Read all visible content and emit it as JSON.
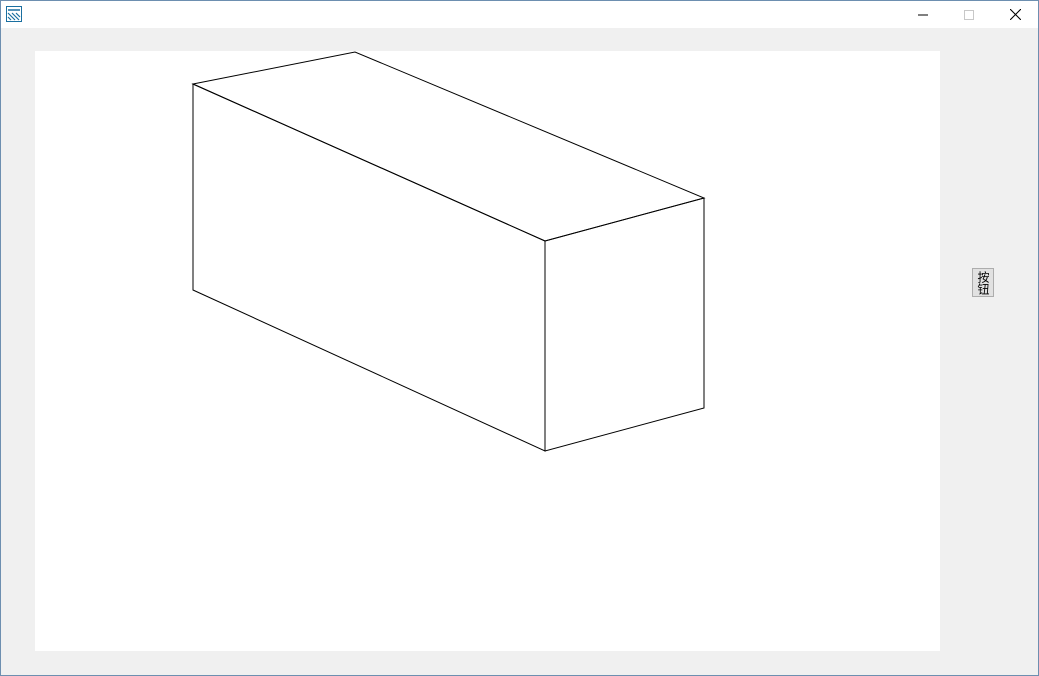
{
  "window": {
    "title": "",
    "app_icon": "app-window-icon",
    "controls": {
      "minimize_icon": "minimize-icon",
      "maximize_icon": "maximize-icon",
      "close_icon": "close-icon"
    }
  },
  "drawing": {
    "shape": "box-wireframe",
    "stroke_color": "#000000"
  },
  "side_button": {
    "label": "按钮"
  },
  "colors": {
    "window_bg": "#f0f0f0",
    "canvas_bg": "#ffffff",
    "border": "#6d8fb0"
  }
}
